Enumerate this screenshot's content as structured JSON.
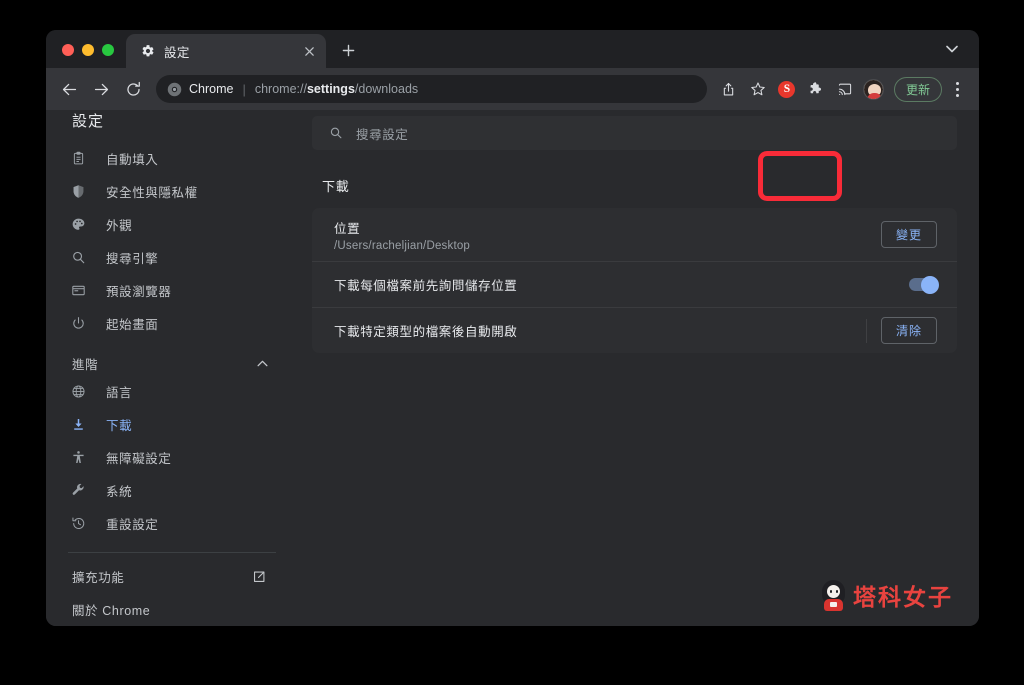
{
  "window": {
    "traffic_lights": [
      "close",
      "minimize",
      "zoom"
    ],
    "colors": {
      "close": "#ff5f57",
      "minimize": "#febc2e",
      "zoom": "#28c840",
      "accent_blue": "#8ab4f8",
      "annotation_red": "#f82b38",
      "update_green": "#81c995",
      "watermark_red": "#e8433f"
    }
  },
  "tab": {
    "favicon": "gear-icon",
    "title": "設定",
    "close_label": "×",
    "newtab_label": "+",
    "tablist_chevron": "chevron-down-icon"
  },
  "toolbar": {
    "back": "back-arrow-icon",
    "forward": "forward-arrow-icon",
    "reload": "reload-icon",
    "omnibox": {
      "page_icon": "chrome-logo-icon",
      "brand": "Chrome",
      "separator": "|",
      "url_prefix": "chrome://",
      "url_bold": "settings",
      "url_suffix": "/downloads"
    },
    "share": "share-icon",
    "bookmark": "star-icon",
    "extension_s": "S",
    "extensions": "puzzle-icon",
    "cast": "cast-icon",
    "profile": "avatar-icon",
    "update_label": "更新",
    "menu": "three-dots-icon"
  },
  "sidebar": {
    "title": "設定",
    "items": [
      {
        "label": "自動填入",
        "icon": "clipboard-icon",
        "active": false
      },
      {
        "label": "安全性與隱私權",
        "icon": "shield-icon",
        "active": false
      },
      {
        "label": "外觀",
        "icon": "palette-icon",
        "active": false
      },
      {
        "label": "搜尋引擎",
        "icon": "search-icon",
        "active": false
      },
      {
        "label": "預設瀏覽器",
        "icon": "browser-window-icon",
        "active": false
      },
      {
        "label": "起始畫面",
        "icon": "power-icon",
        "active": false
      }
    ],
    "advanced": {
      "label": "進階",
      "chevron": "chevron-up-icon",
      "items": [
        {
          "label": "語言",
          "icon": "globe-icon",
          "active": false
        },
        {
          "label": "下載",
          "icon": "download-icon",
          "active": true
        },
        {
          "label": "無障礙設定",
          "icon": "accessibility-icon",
          "active": false
        },
        {
          "label": "系統",
          "icon": "wrench-icon",
          "active": false
        },
        {
          "label": "重設設定",
          "icon": "history-restore-icon",
          "active": false
        }
      ]
    },
    "footer": [
      {
        "label": "擴充功能",
        "icon": "external-link-icon"
      },
      {
        "label": "關於 Chrome",
        "icon": ""
      }
    ]
  },
  "search": {
    "icon": "search-icon",
    "placeholder": "搜尋設定",
    "value": ""
  },
  "main": {
    "section_title": "下載",
    "rows": [
      {
        "label": "位置",
        "sub": "/Users/racheljian/Desktop",
        "action": "變更",
        "action_type": "outline-button",
        "highlighted": true
      },
      {
        "label": "下載每個檔案前先詢問儲存位置",
        "sub": "",
        "action": "toggle",
        "action_type": "toggle",
        "toggle_on": true
      },
      {
        "label": "下載特定類型的檔案後自動開啟",
        "sub": "",
        "action": "清除",
        "action_type": "outline-button",
        "highlighted": false
      }
    ]
  },
  "watermark": {
    "text": "塔科女子",
    "mascot": "girl-mascot-icon"
  }
}
